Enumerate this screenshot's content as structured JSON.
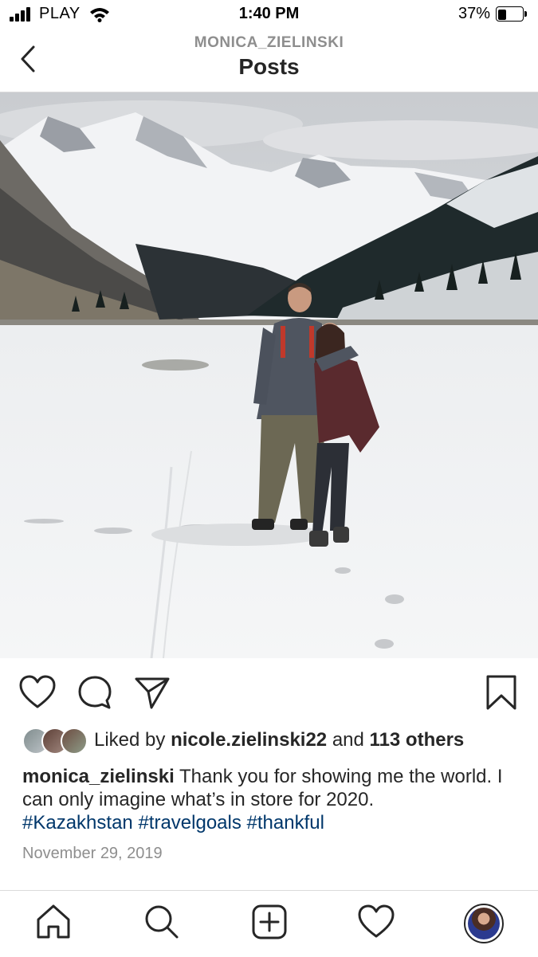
{
  "status_bar": {
    "carrier": "PLAY",
    "time": "1:40 PM",
    "battery_percent": "37%",
    "battery_level": 0.37
  },
  "header": {
    "username": "MONICA_ZIELINSKI",
    "title": "Posts"
  },
  "icons": {
    "back": "chevron-left-icon",
    "like": "heart-icon",
    "comment": "comment-bubble-icon",
    "share": "paper-plane-icon",
    "save": "bookmark-icon",
    "tab_home": "home-icon",
    "tab_search": "search-icon",
    "tab_new": "plus-square-icon",
    "tab_activity": "heart-icon",
    "tab_profile": "profile-avatar-icon"
  },
  "likes": {
    "prefix": "Liked by ",
    "user": "nicole.zielinski22",
    "middle": " and ",
    "others": "113 others"
  },
  "caption": {
    "username": "monica_zielinski",
    "text": " Thank you for showing me the world. I can only imagine what’s in store for 2020.",
    "hashtags": [
      "#Kazakhstan",
      "#travelgoals",
      "#thankful"
    ]
  },
  "post_date": "November 29, 2019",
  "colors": {
    "text": "#262626",
    "muted": "#8e8e8e",
    "hashtag": "#00376b",
    "divider": "#dbdbdb"
  }
}
